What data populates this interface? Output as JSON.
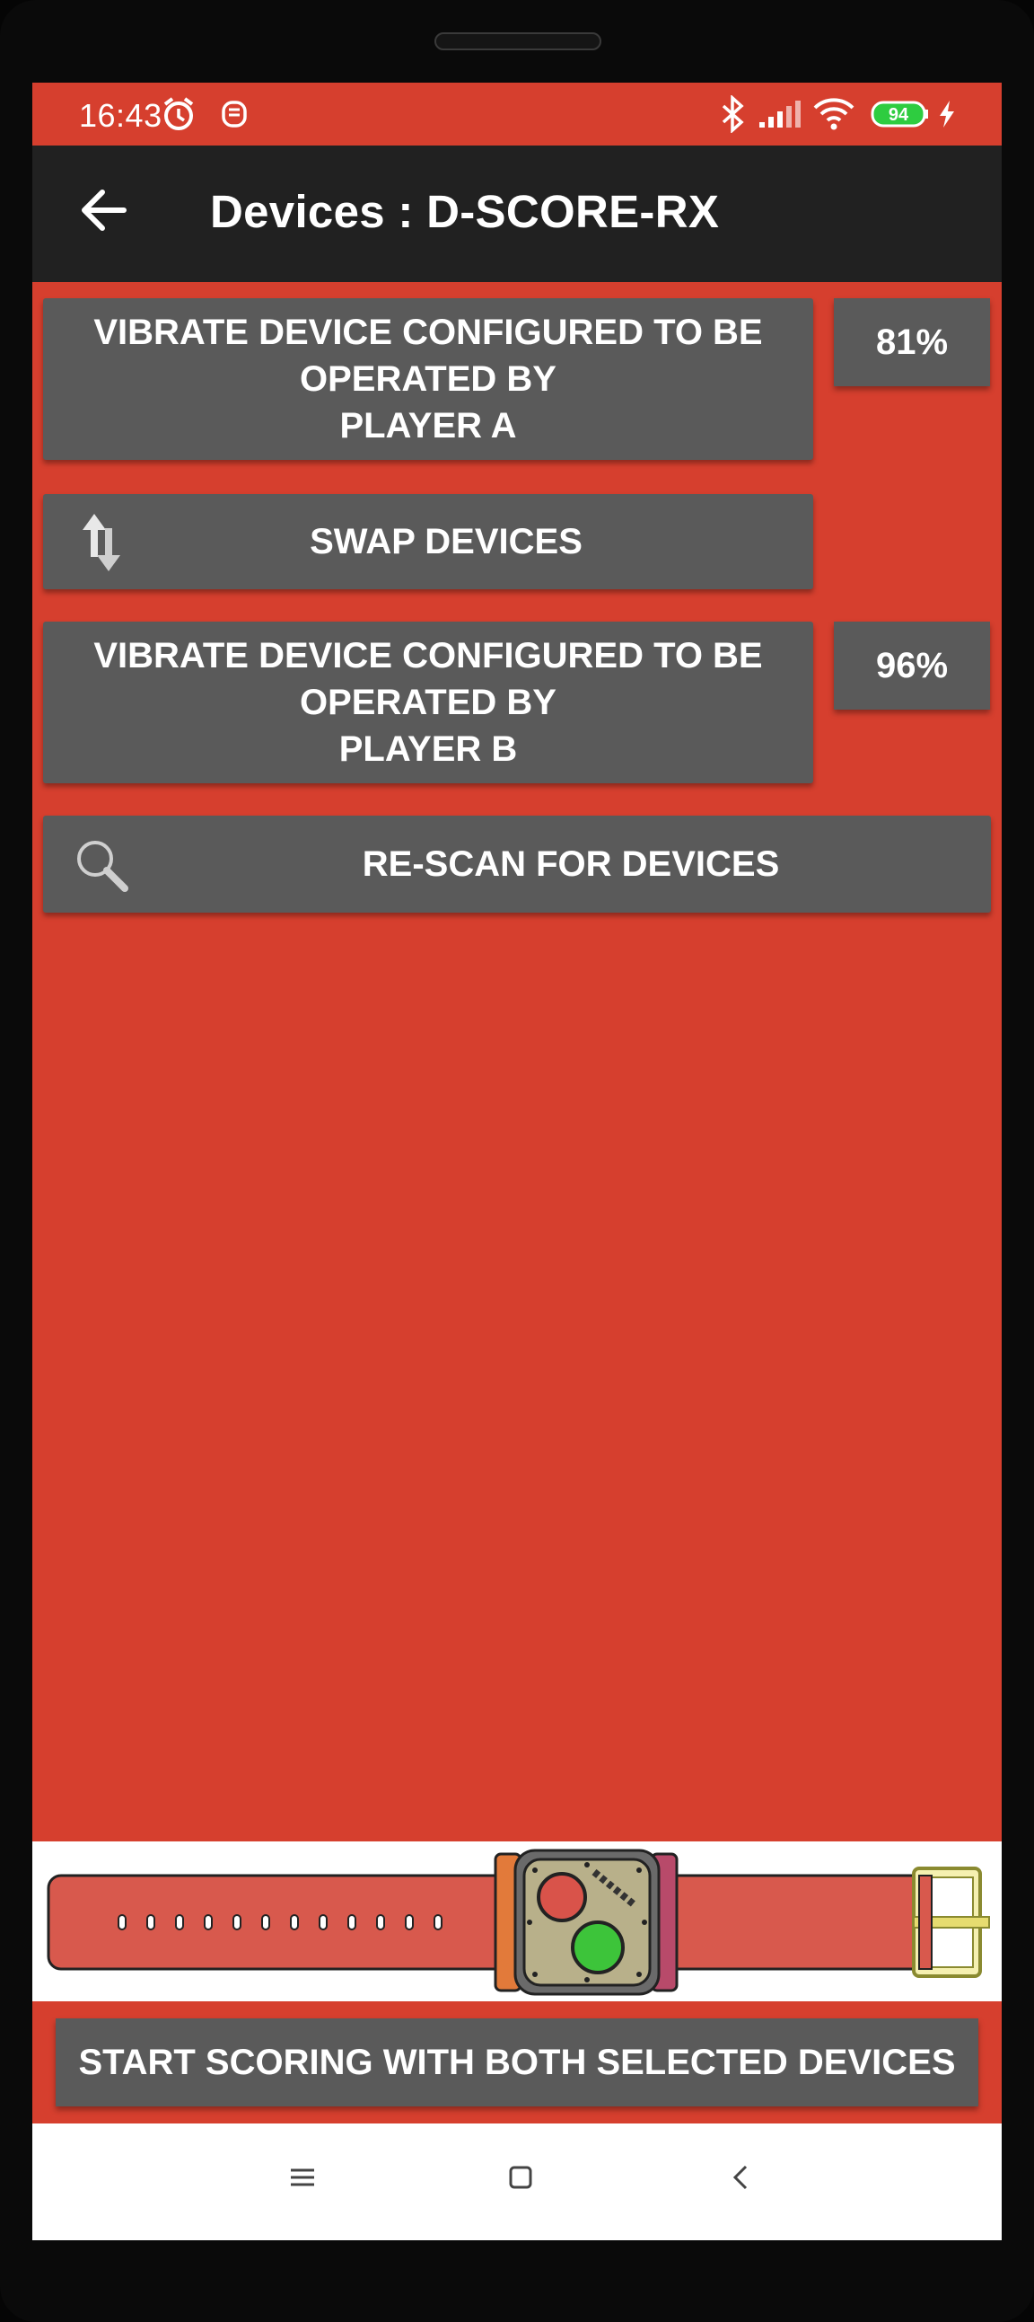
{
  "status_bar": {
    "time": "16:43",
    "battery_level": "94",
    "icons": [
      "alarm-icon",
      "notification-icon",
      "bluetooth-icon",
      "signal-icon",
      "wifi-icon",
      "battery-icon",
      "charging-icon"
    ]
  },
  "app_bar": {
    "back_icon": "arrow-left-icon",
    "title": "Devices : D-SCORE-RX"
  },
  "device_a": {
    "label_line1": "VIBRATE DEVICE CONFIGURED TO BE",
    "label_line2": "OPERATED BY",
    "label_line3": "PLAYER A",
    "battery": "81%"
  },
  "swap": {
    "label": "SWAP DEVICES",
    "icon": "swap-vertical-icon"
  },
  "device_b": {
    "label_line1": "VIBRATE DEVICE CONFIGURED TO BE",
    "label_line2": "OPERATED BY",
    "label_line3": "PLAYER B",
    "battery": "96%"
  },
  "rescan": {
    "label": "RE-SCAN FOR DEVICES",
    "icon": "search-icon"
  },
  "watch_image": {
    "icon": "watch-illustration",
    "strap_color": "#d8594d",
    "face_color": "#b8b08a",
    "button_red": "#d9534a",
    "button_green": "#3dc43a"
  },
  "start": {
    "label": "START SCORING WITH BOTH SELECTED DEVICES"
  },
  "nav": {
    "icons": [
      "menu-icon",
      "home-icon",
      "back-icon"
    ]
  },
  "colors": {
    "background": "#d63f2e",
    "app_bar": "#212121",
    "button": "#5a5a5a"
  }
}
